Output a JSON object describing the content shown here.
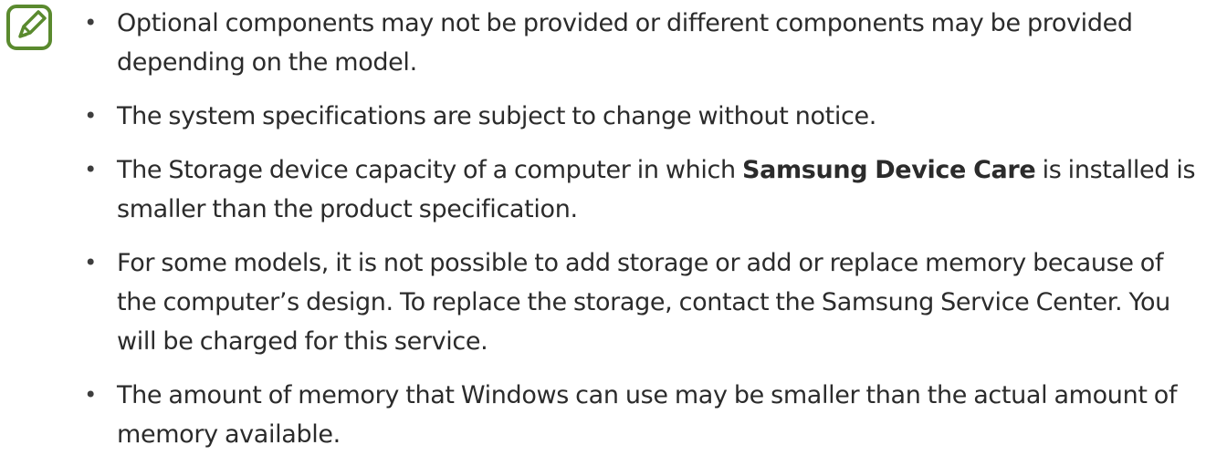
{
  "note_icon": "note-pencil-icon",
  "accent_color": "#5a8a2e",
  "items": [
    {
      "text": "Optional components may not be provided or different components may be provided depending on the model."
    },
    {
      "text": "The system specifications are subject to change without notice."
    },
    {
      "text_before": "The Storage device capacity of a computer in which ",
      "bold": "Samsung Device Care",
      "text_after": " is installed is smaller than the product specification."
    },
    {
      "text": "For some models, it is not possible to add storage or add or replace memory because of the computer’s design. To replace the storage, contact the Samsung Service Center. You will be charged for this service."
    },
    {
      "text": "The amount of memory that Windows can use may be smaller than the actual amount of memory available."
    }
  ],
  "bullet_char": "•"
}
